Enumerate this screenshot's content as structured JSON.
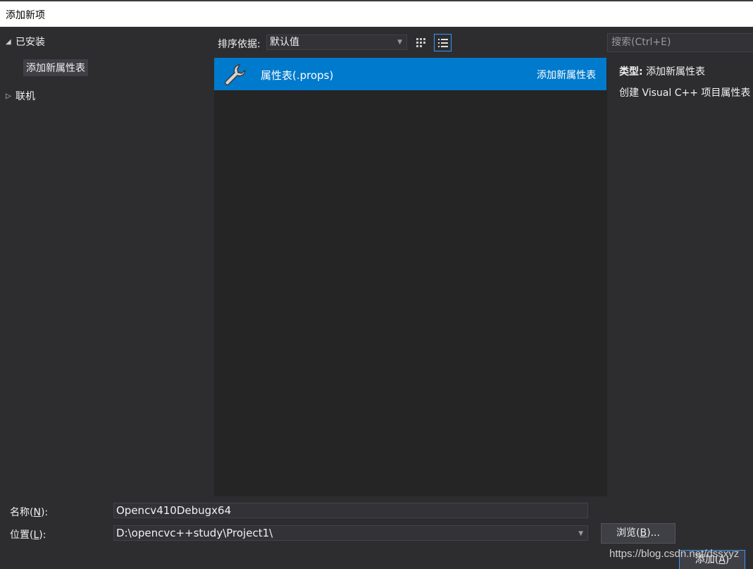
{
  "window": {
    "title": "添加新项"
  },
  "tree": {
    "installed_label": "已安装",
    "installed_child": "添加新属性表",
    "online_label": "联机"
  },
  "toolbar": {
    "sort_label": "排序依据:",
    "sort_value": "默认值",
    "search_placeholder": "搜索(Ctrl+E)"
  },
  "list": {
    "items": [
      {
        "name": "属性表(.props)",
        "type": "添加新属性表",
        "icon": "wrench-icon",
        "selected": true
      }
    ]
  },
  "details": {
    "type_label": "类型:",
    "type_value": "添加新属性表",
    "description": "创建 Visual C++ 项目属性表"
  },
  "form": {
    "name_label_prefix": "名称(",
    "name_label_key": "N",
    "name_label_suffix": "):",
    "name_value": "Opencv410Debugx64",
    "location_label_prefix": "位置(",
    "location_label_key": "L",
    "location_label_suffix": "):",
    "location_value": "D:\\opencvc++study\\Project1\\",
    "browse_prefix": "浏览(",
    "browse_key": "B",
    "browse_suffix": ")...",
    "add_prefix": "添加(",
    "add_key": "A",
    "add_suffix": ")"
  },
  "watermark": "https://blog.csdn.net/dssxyz",
  "colors": {
    "accent": "#007acc",
    "background": "#2d2d30",
    "list_bg": "#252526"
  }
}
